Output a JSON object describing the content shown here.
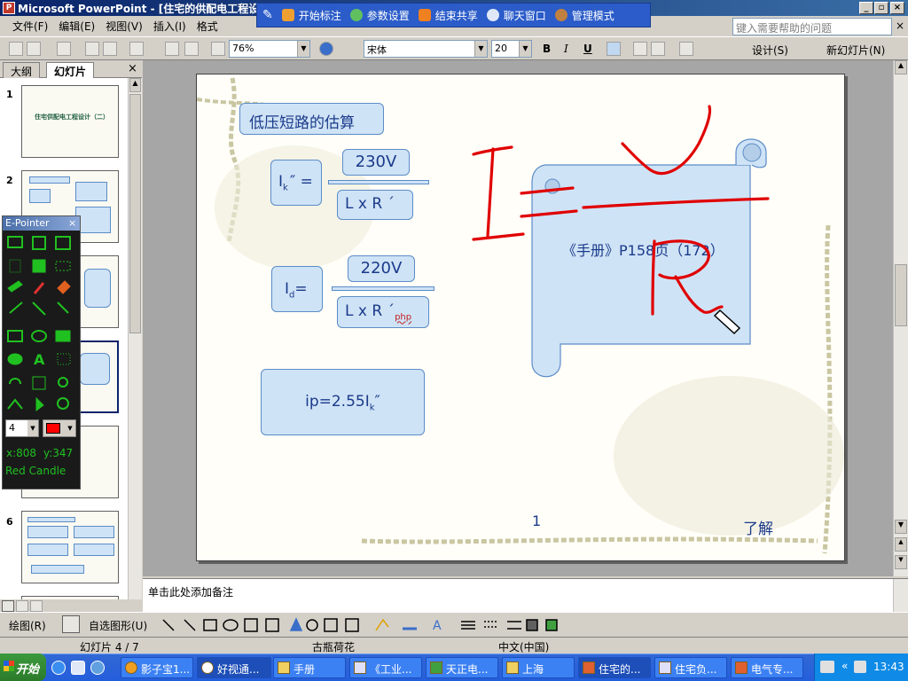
{
  "window": {
    "title": "Microsoft PowerPoint - [住宅的供配电工程设计",
    "btn_min": "_",
    "btn_restore": "▫",
    "btn_close": "×"
  },
  "epointer_top": {
    "items": [
      "开始标注",
      "参数设置",
      "结束共享",
      "聊天窗口",
      "管理模式"
    ]
  },
  "menu": {
    "items": [
      "文件(F)",
      "编辑(E)",
      "视图(V)",
      "插入(I)",
      "格式"
    ],
    "help_placeholder": "键入需要帮助的问题"
  },
  "toolbar": {
    "zoom": "76%",
    "font": "宋体",
    "font_size": "20",
    "bold": "B",
    "italic": "I",
    "underline": "U",
    "design": "设计(S)",
    "new_slide": "新幻灯片(N)"
  },
  "left_pane": {
    "tab_outline": "大纲",
    "tab_slides": "幻灯片",
    "close": "×",
    "slide_numbers": [
      "1",
      "2",
      "6"
    ],
    "thumb1_title": "住宅供配电工程设计（二）"
  },
  "epointer_palette": {
    "title": "E-Pointer",
    "close": "×",
    "pen_width": "4",
    "pen_color": "#ff0000",
    "coord_x": "x:808",
    "coord_y": "y:347",
    "pen_name": "Red Candle"
  },
  "slide": {
    "title": "低压短路的估算",
    "ik_label": "I",
    "ik_sub": "k",
    "ik_prime": "″ =",
    "v230": "230V",
    "lxr1": "L x R ´",
    "id_label": "I",
    "id_sub": "d",
    "id_eq": "=",
    "v220": "220V",
    "lxr2": "L x R ´",
    "lxr2_sub": "php",
    "ip_formula": "ip=2.55I",
    "ip_sub": "k",
    "ip_prime": "″",
    "scroll_text": "《手册》P158页（172）",
    "page_number": "1",
    "understand": "了解",
    "annotation_color": "#e00000"
  },
  "notes": {
    "placeholder": "单击此处添加备注"
  },
  "drawbar": {
    "draw": "绘图(R)",
    "autoshape": "自选图形(U)"
  },
  "status": {
    "slide_info": "幻灯片 4 / 7",
    "design_name": "古瓶荷花",
    "language": "中文(中国)"
  },
  "taskbar": {
    "start": "开始",
    "tasks": [
      "影子宝1...",
      "好视通...",
      "手册",
      "《工业...",
      "天正电...",
      "上海",
      "住宅的...",
      "住宅负...",
      "电气专..."
    ],
    "clock": "13:43"
  }
}
